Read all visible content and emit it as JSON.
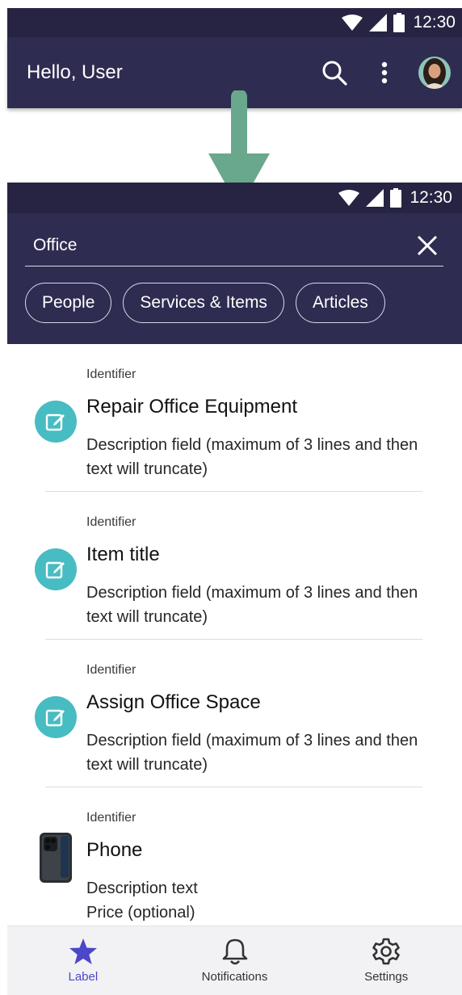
{
  "top_screen": {
    "status_time": "12:30",
    "greeting": "Hello, User",
    "icons": [
      "search-icon",
      "more-vert-icon",
      "avatar"
    ]
  },
  "search_screen": {
    "status_time": "12:30",
    "search_value": "Office",
    "chips": [
      "People",
      "Services & Items",
      "Articles"
    ]
  },
  "results": [
    {
      "identifier": "Identifier",
      "title": "Repair Office Equipment",
      "description": "Description field (maximum of 3 lines and then text will truncate)",
      "icon": "edit-icon"
    },
    {
      "identifier": "Identifier",
      "title": "Item title",
      "description": "Description field (maximum of 3 lines and then text will truncate)",
      "icon": "edit-icon"
    },
    {
      "identifier": "Identifier",
      "title": "Assign Office Space",
      "description": "Description field (maximum of 3 lines and then text will truncate)",
      "icon": "edit-icon"
    },
    {
      "identifier": "Identifier",
      "title": "Phone",
      "description": "Description text",
      "price": "Price (optional)",
      "icon": "phone-image"
    }
  ],
  "bottom_nav": [
    {
      "label": "Label",
      "icon": "star-icon",
      "active": true
    },
    {
      "label": "Notifications",
      "icon": "bell-icon",
      "active": false
    },
    {
      "label": "Settings",
      "icon": "gear-icon",
      "active": false
    }
  ],
  "colors": {
    "app_bar": "#2f2c51",
    "status_bar": "#262442",
    "accent": "#4c46c9",
    "teal_icon": "#47bcc2",
    "arrow": "#6aa88d"
  }
}
